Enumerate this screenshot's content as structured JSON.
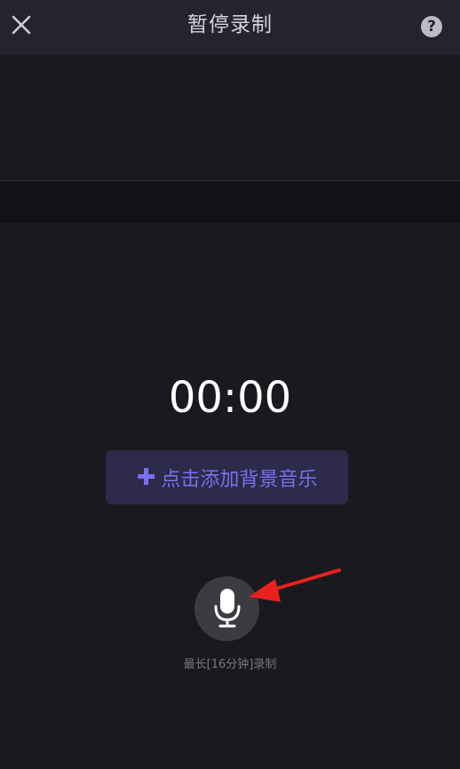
{
  "header": {
    "title": "暂停录制",
    "close_icon": "close-icon",
    "help_icon": "help-icon",
    "help_symbol": "?"
  },
  "recorder": {
    "timer": "00:00",
    "bgm_button": {
      "plus": "✚",
      "label": "点击添加背景音乐"
    },
    "mic_icon": "microphone-icon",
    "hint": "最长[16分钟]录制"
  },
  "annotation": {
    "arrow_color": "#e8211e"
  },
  "colors": {
    "background": "#1a191e",
    "header": "#252330",
    "accent": "#7a6ff0",
    "accent_bg": "#2d2a4a"
  }
}
